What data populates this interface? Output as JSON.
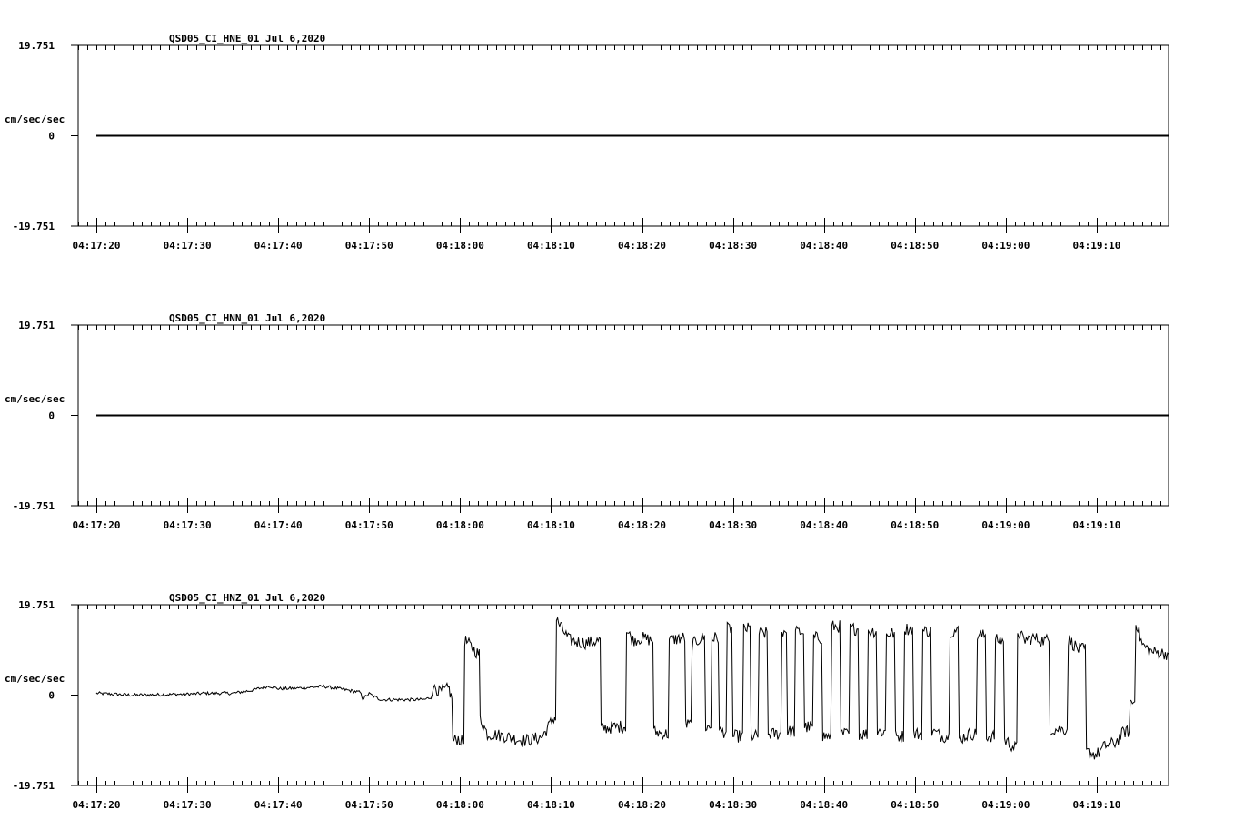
{
  "chart_data": [
    {
      "type": "line",
      "title": "QSD05_CI_HNE_01  Jul 6,2020",
      "ylabel": "cm/sec/sec",
      "ylim": [
        -19.751,
        19.751
      ],
      "ytick_labels": [
        "19.751",
        "0",
        "-19.751"
      ],
      "xtick_labels": [
        "04:17:20",
        "04:17:30",
        "04:17:40",
        "04:17:50",
        "04:18:00",
        "04:18:10",
        "04:18:20",
        "04:18:30",
        "04:18:40",
        "04:18:50",
        "04:19:00",
        "04:19:10"
      ],
      "x_seconds_range": [
        -22.0,
        97.9
      ],
      "x_tick_seconds": [
        -20,
        -10,
        0,
        10,
        20,
        30,
        40,
        50,
        60,
        70,
        80,
        90
      ],
      "series": [
        {
          "values": [
            [
              -20,
              0
            ],
            [
              97.9,
              0
            ]
          ]
        }
      ]
    },
    {
      "type": "line",
      "title": "QSD05_CI_HNN_01  Jul 6,2020",
      "ylabel": "cm/sec/sec",
      "ylim": [
        -19.751,
        19.751
      ],
      "ytick_labels": [
        "19.751",
        "0",
        "-19.751"
      ],
      "xtick_labels": [
        "04:17:20",
        "04:17:30",
        "04:17:40",
        "04:17:50",
        "04:18:00",
        "04:18:10",
        "04:18:20",
        "04:18:30",
        "04:18:40",
        "04:18:50",
        "04:19:00",
        "04:19:10"
      ],
      "x_seconds_range": [
        -22.0,
        97.9
      ],
      "x_tick_seconds": [
        -20,
        -10,
        0,
        10,
        20,
        30,
        40,
        50,
        60,
        70,
        80,
        90
      ],
      "series": [
        {
          "values": [
            [
              -20,
              0
            ],
            [
              97.9,
              0
            ]
          ]
        }
      ]
    },
    {
      "type": "line",
      "title": "QSD05_CI_HNZ_01  Jul 6,2020",
      "ylabel": "cm/sec/sec",
      "ylim": [
        -19.751,
        19.751
      ],
      "ytick_labels": [
        "19.751",
        "0",
        "-19.751"
      ],
      "xtick_labels": [
        "04:17:20",
        "04:17:30",
        "04:17:40",
        "04:17:50",
        "04:18:00",
        "04:18:10",
        "04:18:20",
        "04:18:30",
        "04:18:40",
        "04:18:50",
        "04:19:00",
        "04:19:10"
      ],
      "x_seconds_range": [
        -22.0,
        97.9
      ],
      "x_tick_seconds": [
        -20,
        -10,
        0,
        10,
        20,
        30,
        40,
        50,
        60,
        70,
        80,
        90
      ],
      "series": [
        {
          "values": [
            [
              -20,
              0.4
            ],
            [
              -18,
              0.2
            ],
            [
              -16,
              0.0
            ],
            [
              -13,
              0.1
            ],
            [
              -10,
              0.2
            ],
            [
              -8,
              0.4
            ],
            [
              -5,
              0.4
            ],
            [
              -3,
              1.0
            ],
            [
              -1,
              2.0
            ],
            [
              0,
              1.4
            ],
            [
              2,
              1.5
            ],
            [
              5,
              1.9
            ],
            [
              7,
              1.3
            ],
            [
              9,
              0.6
            ],
            [
              9.3,
              -0.8
            ],
            [
              10,
              0.3
            ],
            [
              11,
              -0.8
            ],
            [
              11.5,
              -1.0
            ],
            [
              14,
              -1.0
            ],
            [
              16,
              -1.0
            ],
            [
              16.8,
              -0.5
            ],
            [
              17.2,
              2.2
            ],
            [
              17.7,
              0.6
            ],
            [
              18.8,
              1.4
            ],
            [
              19.0,
              -0.4
            ],
            [
              19.2,
              -10.0
            ],
            [
              19.8,
              -9.5
            ],
            [
              20.3,
              -10.4
            ],
            [
              20.5,
              12.0
            ],
            [
              22,
              9.0
            ],
            [
              22.2,
              -5.0
            ],
            [
              23,
              -8.5
            ],
            [
              24,
              -8.7
            ],
            [
              25,
              -9.0
            ],
            [
              27,
              -10.0
            ],
            [
              29,
              -9.2
            ],
            [
              30.3,
              -5.0
            ],
            [
              30.6,
              16.4
            ],
            [
              32,
              12.0
            ],
            [
              33,
              11.6
            ],
            [
              34,
              11.4
            ],
            [
              35.3,
              11.9
            ],
            [
              35.5,
              -7.3
            ],
            [
              37,
              -7.0
            ],
            [
              38,
              -6.8
            ],
            [
              38.3,
              14.0
            ],
            [
              39,
              12.0
            ],
            [
              40,
              12.5
            ],
            [
              41,
              12.0
            ],
            [
              41.3,
              -8.0
            ],
            [
              42.5,
              -8.5
            ],
            [
              43,
              12.0
            ],
            [
              44.5,
              12.5
            ],
            [
              44.8,
              -6.5
            ],
            [
              45.5,
              11.0
            ],
            [
              46.5,
              12.5
            ],
            [
              47,
              -7.0
            ],
            [
              47.8,
              12.5
            ],
            [
              48.5,
              -8.0
            ],
            [
              49.5,
              14.5
            ],
            [
              50,
              -9.0
            ],
            [
              51.3,
              14.5
            ],
            [
              52,
              -9.0
            ],
            [
              53,
              13.5
            ],
            [
              54,
              -8.5
            ],
            [
              55.5,
              14.0
            ],
            [
              56,
              -8.0
            ],
            [
              57,
              13.8
            ],
            [
              58,
              -7.0
            ],
            [
              59,
              12.5
            ],
            [
              60,
              -9.0
            ],
            [
              61,
              15.0
            ],
            [
              62,
              -8.5
            ],
            [
              63,
              14.5
            ],
            [
              64,
              -8.5
            ],
            [
              65,
              14.0
            ],
            [
              66,
              -8.0
            ],
            [
              67,
              13.5
            ],
            [
              68,
              -9.0
            ],
            [
              69,
              14.5
            ],
            [
              70,
              -8.5
            ],
            [
              71,
              14.0
            ],
            [
              72,
              -8.0
            ],
            [
              73,
              -9.0
            ],
            [
              74,
              14.0
            ],
            [
              75,
              -9.5
            ],
            [
              76,
              -8.5
            ],
            [
              77,
              13.0
            ],
            [
              78,
              -9.0
            ],
            [
              79,
              12.0
            ],
            [
              80,
              -10.0
            ],
            [
              81,
              -11.5
            ],
            [
              81.3,
              14.0
            ],
            [
              82,
              12.0
            ],
            [
              83,
              12.5
            ],
            [
              84,
              12.0
            ],
            [
              85,
              -7.5
            ],
            [
              86,
              -7.5
            ],
            [
              87,
              12.0
            ],
            [
              88,
              10.0
            ],
            [
              89,
              -12.5
            ],
            [
              90,
              -13.0
            ],
            [
              91,
              -11.0
            ],
            [
              92,
              -10.5
            ],
            [
              93,
              -8.0
            ],
            [
              93.8,
              -1.5
            ],
            [
              94.3,
              16.4
            ],
            [
              95,
              11.0
            ],
            [
              96,
              9.5
            ],
            [
              97.9,
              9.0
            ]
          ]
        }
      ]
    }
  ]
}
